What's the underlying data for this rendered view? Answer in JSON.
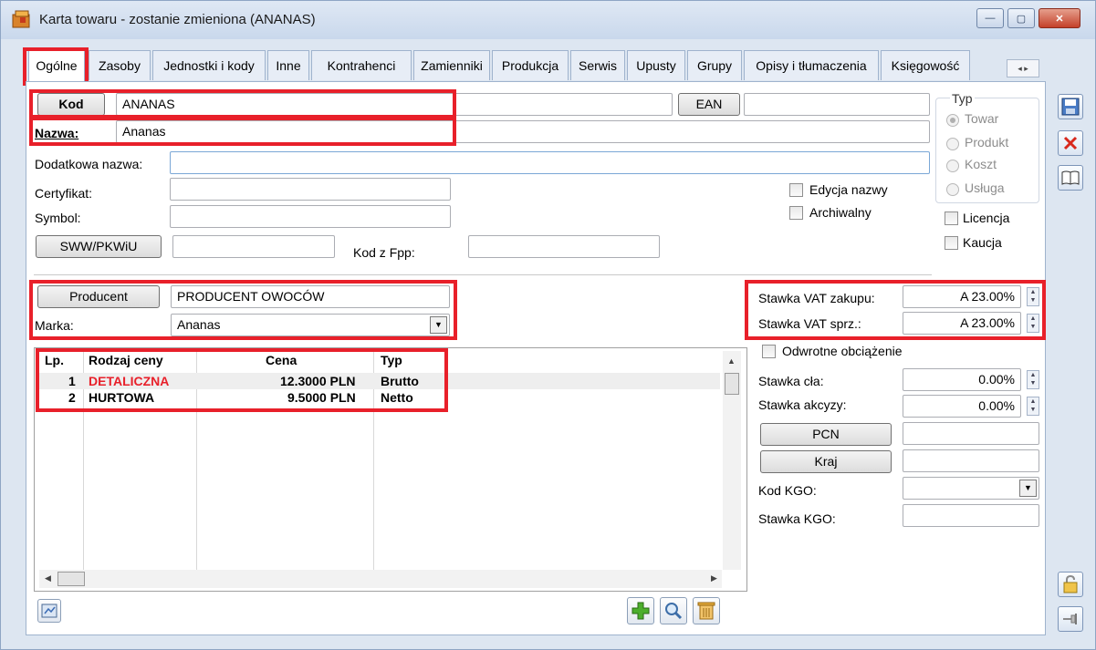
{
  "window": {
    "title": "Karta towaru - zostanie zmieniona (ANANAS)",
    "min_glyph": "—",
    "max_glyph": "▢",
    "close_glyph": "✕"
  },
  "tabs": [
    {
      "label": "Ogólne"
    },
    {
      "label": "Zasoby"
    },
    {
      "label": "Jednostki i kody"
    },
    {
      "label": "Inne"
    },
    {
      "label": "Kontrahenci"
    },
    {
      "label": "Zamienniki"
    },
    {
      "label": "Produkcja"
    },
    {
      "label": "Serwis"
    },
    {
      "label": "Upusty"
    },
    {
      "label": "Grupy"
    },
    {
      "label": "Opisy i tłumaczenia"
    },
    {
      "label": "Księgowość"
    }
  ],
  "tab_scroll": "◂ ▸",
  "form": {
    "kod_button": "Kod",
    "kod_value": "ANANAS",
    "ean_button": "EAN",
    "ean_value": "",
    "nazwa_label": "Nazwa:",
    "nazwa_value": "Ananas",
    "dodatkowa_label": "Dodatkowa nazwa:",
    "certyfikat_label": "Certyfikat:",
    "symbol_label": "Symbol:",
    "sww_button": "SWW/PKWiU",
    "kod_fpp_label": "Kod z Fpp:",
    "edycja_nazwy": "Edycja nazwy",
    "archiwalny": "Archiwalny",
    "licencja": "Licencja",
    "kaucja": "Kaucja",
    "typ_label": "Typ",
    "typ_options": [
      "Towar",
      "Produkt",
      "Koszt",
      "Usługa"
    ],
    "producent_button": "Producent",
    "producent_value": "PRODUCENT OWOCÓW",
    "marka_label": "Marka:",
    "marka_value": "Ananas",
    "vat_zakupu_label": "Stawka VAT zakupu:",
    "vat_zakupu_value": "A 23.00%",
    "vat_sprz_label": "Stawka VAT sprz.:",
    "vat_sprz_value": "A 23.00%",
    "odwrotne_label": "Odwrotne obciążenie",
    "stawka_cla_label": "Stawka cła:",
    "stawka_cla_value": "0.00%",
    "stawka_akcyzy_label": "Stawka akcyzy:",
    "stawka_akcyzy_value": "0.00%",
    "pcn_button": "PCN",
    "kraj_button": "Kraj",
    "kod_kgo_label": "Kod KGO:",
    "stawka_kgo_label": "Stawka KGO:"
  },
  "price_grid": {
    "headers": [
      "Lp.",
      "Rodzaj ceny",
      "Cena",
      "Typ"
    ],
    "rows": [
      {
        "lp": "1",
        "rodzaj": "DETALICZNA",
        "cena": "12.3000 PLN",
        "typ": "Brutto",
        "rodzaj_color": "#e8202a"
      },
      {
        "lp": "2",
        "rodzaj": "HURTOWA",
        "cena": "9.5000 PLN",
        "typ": "Netto",
        "rodzaj_color": "#000000"
      }
    ]
  },
  "colors": {
    "highlight": "#e8202a",
    "window_bg": "#dde6f1"
  }
}
